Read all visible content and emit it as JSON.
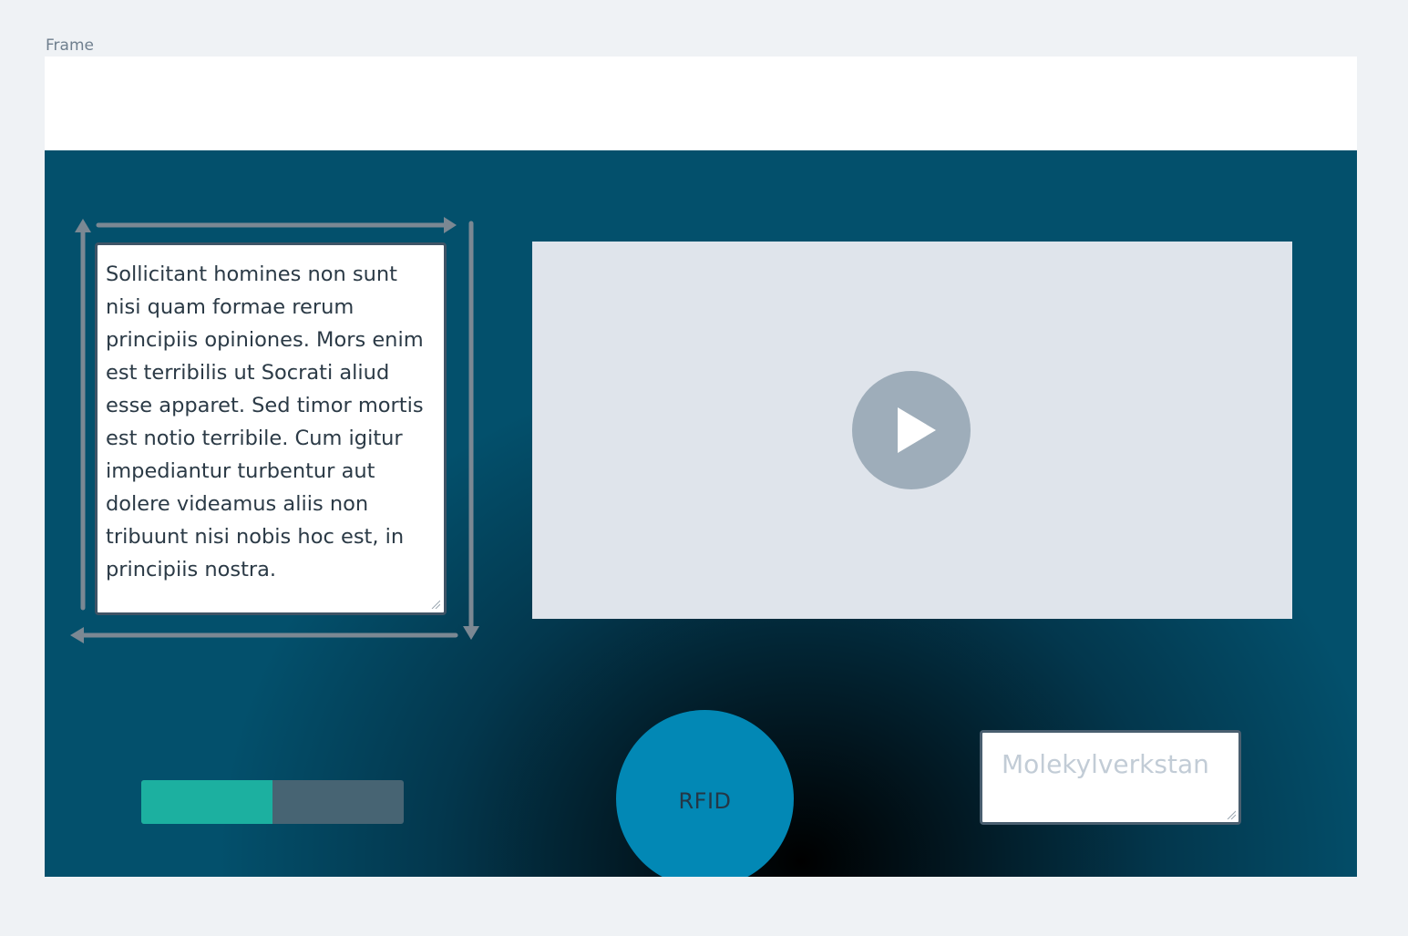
{
  "frame": {
    "label": "Frame"
  },
  "textbox": {
    "value": "Sollicitant homines non sunt nisi quam formae rerum principiis opiniones. Mors enim est terribilis ut Socrati aliud esse apparet. Sed timor mortis est notio terribile. Cum igitur impediantur turbentur aut dolere videamus aliis non tribuunt nisi nobis hoc est, in principiis nostra."
  },
  "video": {
    "play_icon": "play-icon"
  },
  "progress": {
    "value_fraction": 0.5
  },
  "rfid_button": {
    "label": "RFID"
  },
  "name_input": {
    "placeholder": "Molekylverkstan"
  },
  "colors": {
    "progress_fill": "#1cb0a0",
    "progress_track": "#476473",
    "rfid_button": "#0288b5",
    "stage_outer": "#03506c",
    "stage_center": "#000000",
    "video_bg": "#dfe4eb",
    "play_button": "#9eadba"
  }
}
